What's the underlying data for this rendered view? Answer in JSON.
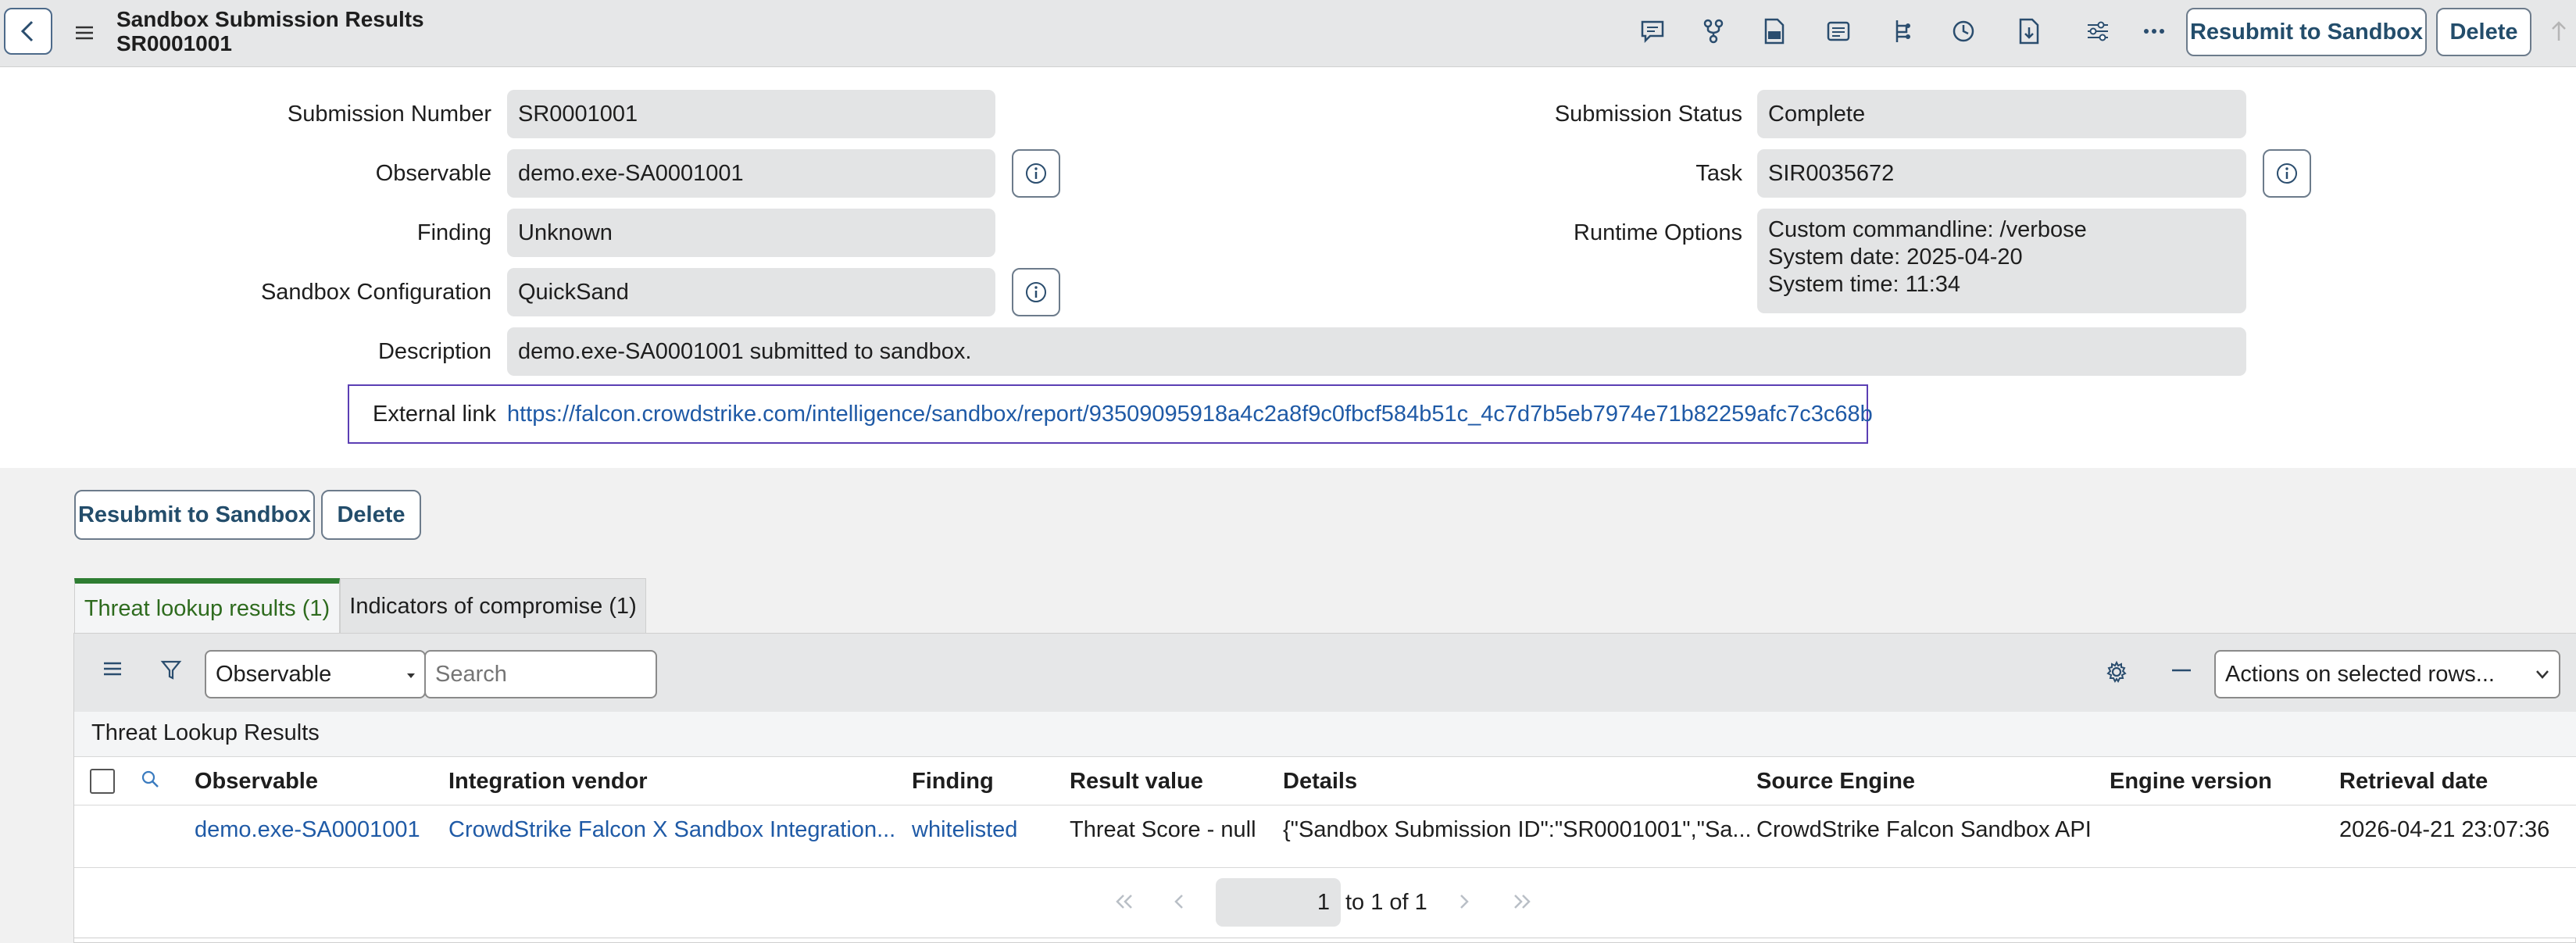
{
  "header": {
    "title": "Sandbox Submission Results",
    "record": "SR0001001",
    "resubmit_label": "Resubmit to Sandbox",
    "delete_label": "Delete"
  },
  "form": {
    "submission_number": {
      "label": "Submission Number",
      "value": "SR0001001"
    },
    "observable": {
      "label": "Observable",
      "value": "demo.exe-SA0001001"
    },
    "finding": {
      "label": "Finding",
      "value": "Unknown"
    },
    "sandbox_configuration": {
      "label": "Sandbox Configuration",
      "value": "QuickSand"
    },
    "description": {
      "label": "Description",
      "value": "demo.exe-SA0001001 submitted to sandbox."
    },
    "external_link": {
      "label": "External link",
      "value": "https://falcon.crowdstrike.com/intelligence/sandbox/report/93509095918a4c2a8f9c0fbcf584b51c_4c7d7b5eb7974e71b82259afc7c3c68b"
    },
    "submission_status": {
      "label": "Submission Status",
      "value": "Complete"
    },
    "task": {
      "label": "Task",
      "value": "SIR0035672"
    },
    "runtime_options": {
      "label": "Runtime Options",
      "lines": [
        "Custom commandline: /verbose",
        "System date: 2025-04-20",
        "System time: 11:34"
      ]
    }
  },
  "actions": {
    "resubmit_label": "Resubmit to Sandbox",
    "delete_label": "Delete"
  },
  "tabs": [
    {
      "label": "Threat lookup results (1)",
      "active": true
    },
    {
      "label": "Indicators of compromise (1)",
      "active": false
    }
  ],
  "list": {
    "filter_field": "Observable",
    "search_placeholder": "Search",
    "actions_select": "Actions on selected rows...",
    "caption": "Threat Lookup Results",
    "columns": [
      "Observable",
      "Integration vendor",
      "Finding",
      "Result value",
      "Details",
      "Source Engine",
      "Engine version",
      "Retrieval date"
    ],
    "rows": [
      [
        "demo.exe-SA0001001",
        "CrowdStrike Falcon X Sandbox Integration...",
        "whitelisted",
        "Threat Score - null",
        "{\"Sandbox Submission ID\":\"SR0001001\",\"Sa...",
        "CrowdStrike Falcon Sandbox API",
        "",
        "2026-04-21 23:07:36"
      ]
    ],
    "pagination": {
      "page": "1",
      "range_text": "to 1 of 1"
    }
  },
  "colors": {
    "accent": "#234d6b",
    "link": "#1f5aa6",
    "active_tab": "#2e7d32",
    "focus_outline": "#5b3fb4"
  }
}
